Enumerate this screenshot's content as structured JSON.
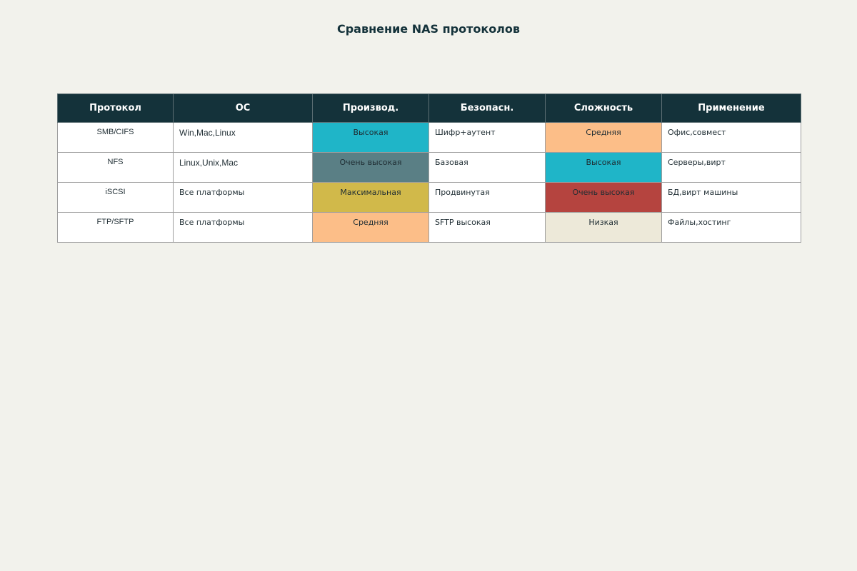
{
  "colors": {
    "page_bg": "#f2f2ec",
    "header_bg": "#14323a",
    "header_text": "#ffffff",
    "cell_bg": "#ffffff",
    "border": "#9e9e9e",
    "levels": {
      "Высокая": "#1fb5c8",
      "Очень высокая": "#5a7f85",
      "Максимальная": "#d1b94a",
      "Средняя": "#fcbe88",
      "Очень высокая (сложность)": "#b5443f",
      "Низкая": "#ede9d9"
    }
  },
  "chart_data": {
    "type": "table",
    "title": "Сравнение NAS протоколов",
    "columns": [
      "Протокол",
      "ОС",
      "Производ.",
      "Безопасн.",
      "Сложность",
      "Применение"
    ],
    "rows": [
      {
        "protocol": "SMB/CIFS",
        "os": "Win,Mac,Linux",
        "performance": "Высокая",
        "performance_color": "#1fb5c8",
        "security": "Шифр+аутент",
        "complexity": "Средняя",
        "complexity_color": "#fcbe88",
        "usage": "Офис,совмест"
      },
      {
        "protocol": "NFS",
        "os": "Linux,Unix,Mac",
        "performance": "Очень высокая",
        "performance_color": "#5a7f85",
        "security": "Базовая",
        "complexity": "Высокая",
        "complexity_color": "#1fb5c8",
        "usage": "Серверы,вирт"
      },
      {
        "protocol": "iSCSI",
        "os": "Все платформы",
        "performance": "Максимальная",
        "performance_color": "#d1b94a",
        "security": "Продвинутая",
        "complexity": "Очень высокая",
        "complexity_color": "#b5443f",
        "usage": "БД,вирт машины"
      },
      {
        "protocol": "FTP/SFTP",
        "os": "Все платформы",
        "performance": "Средняя",
        "performance_color": "#fcbe88",
        "security": "SFTP высокая",
        "complexity": "Низкая",
        "complexity_color": "#ede9d9",
        "usage": "Файлы,хостинг"
      }
    ]
  }
}
